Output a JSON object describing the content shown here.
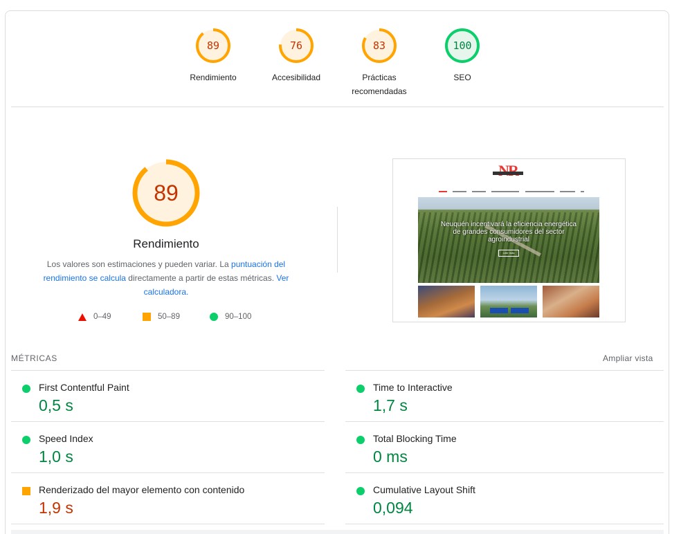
{
  "scores": [
    {
      "value": "89",
      "label": "Rendimiento",
      "fraction": 0.89,
      "color": "#ffa400",
      "text_color": "#c33300",
      "bg": "#fff3e0"
    },
    {
      "value": "76",
      "label": "Accesibilidad",
      "fraction": 0.76,
      "color": "#ffa400",
      "text_color": "#c33300",
      "bg": "#fff3e0"
    },
    {
      "value": "83",
      "label": "Prácticas recomendadas",
      "fraction": 0.83,
      "color": "#ffa400",
      "text_color": "#c33300",
      "bg": "#fff3e0"
    },
    {
      "value": "100",
      "label": "SEO",
      "fraction": 1.0,
      "color": "#0cce6b",
      "text_color": "#018642",
      "bg": "#e6f6ec"
    }
  ],
  "performance": {
    "score": "89",
    "fraction": 0.89,
    "title": "Rendimiento",
    "desc_prefix": "Los valores son estimaciones y pueden variar. La ",
    "desc_link1": "puntuación del rendimiento se calcula",
    "desc_middle": " directamente a partir de estas métricas. ",
    "desc_link2": "Ver calculadora."
  },
  "legend": {
    "fail": "0–49",
    "average": "50–89",
    "pass": "90–100"
  },
  "preview": {
    "hero_caption": "Neuquén incentivará la eficiencia energética de grandes consumidores del sector agroindustrial",
    "hero_button": "Leer más"
  },
  "metrics_section": {
    "title": "MÉTRICAS",
    "expand_label": "Ampliar vista"
  },
  "metrics": [
    {
      "name": "First Contentful Paint",
      "value": "0,5 s",
      "status": "pass"
    },
    {
      "name": "Time to Interactive",
      "value": "1,7 s",
      "status": "pass"
    },
    {
      "name": "Speed Index",
      "value": "1,0 s",
      "status": "pass"
    },
    {
      "name": "Total Blocking Time",
      "value": "0 ms",
      "status": "pass"
    },
    {
      "name": "Renderizado del mayor elemento con contenido",
      "value": "1,9 s",
      "status": "average"
    },
    {
      "name": "Cumulative Layout Shift",
      "value": "0,094",
      "status": "pass"
    }
  ],
  "colors": {
    "pass": "#0cce6b",
    "average": "#ffa400",
    "fail": "#eb0f00",
    "link": "#1a73e8"
  }
}
